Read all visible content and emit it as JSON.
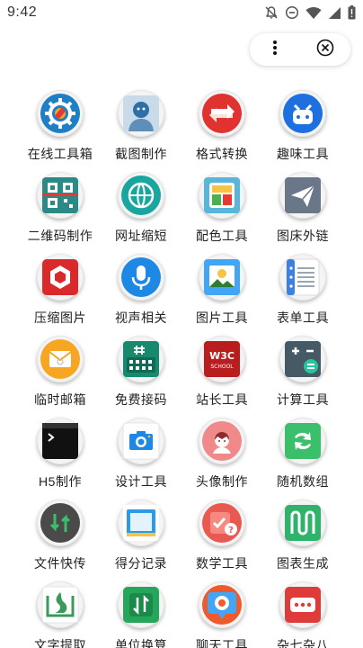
{
  "status_bar": {
    "time": "9:42",
    "icons": [
      "notifications-off-icon",
      "do-not-disturb-icon",
      "wifi-icon",
      "signal-icon",
      "battery-alert-icon"
    ]
  },
  "capsule": {
    "more_icon": "more-vertical-icon",
    "close_icon": "close-circle-icon"
  },
  "tools": [
    {
      "label": "在线工具箱",
      "icon": "gear-wrench-icon",
      "color": "#1f7fc4"
    },
    {
      "label": "截图制作",
      "icon": "portrait-photo-icon",
      "color": "#9ab8d6"
    },
    {
      "label": "格式转换",
      "icon": "swap-arrows-icon",
      "color": "#e0322f"
    },
    {
      "label": "趣味工具",
      "icon": "robot-face-icon",
      "color": "#1e6fe0"
    },
    {
      "label": "二维码制作",
      "icon": "qr-code-icon",
      "color": "#2b8a86"
    },
    {
      "label": "网址缩短",
      "icon": "globe-icon",
      "color": "#1aa6a0"
    },
    {
      "label": "配色工具",
      "icon": "color-palette-icon",
      "color": "#58b7d9"
    },
    {
      "label": "图床外链",
      "icon": "paper-plane-icon",
      "color": "#6a7788"
    },
    {
      "label": "压缩图片",
      "icon": "compress-hexagon-icon",
      "color": "#d9292b"
    },
    {
      "label": "视声相关",
      "icon": "microphone-icon",
      "color": "#1e88e5"
    },
    {
      "label": "图片工具",
      "icon": "picture-icon",
      "color": "#42a5f5"
    },
    {
      "label": "表单工具",
      "icon": "form-list-icon",
      "color": "#3f7fe0"
    },
    {
      "label": "临时邮箱",
      "icon": "email-envelope-icon",
      "color": "#f6a623"
    },
    {
      "label": "免费接码",
      "icon": "keypad-hash-icon",
      "color": "#178a6e"
    },
    {
      "label": "站长工具",
      "icon": "w3c-school-icon",
      "color": "#b91d1d"
    },
    {
      "label": "计算工具",
      "icon": "calculator-icon",
      "color": "#455a64"
    },
    {
      "label": "H5制作",
      "icon": "terminal-window-icon",
      "color": "#111111"
    },
    {
      "label": "设计工具",
      "icon": "camera-icon",
      "color": "#1e88e5"
    },
    {
      "label": "头像制作",
      "icon": "avatar-face-icon",
      "color": "#f08a8a"
    },
    {
      "label": "随机数组",
      "icon": "shuffle-arrows-icon",
      "color": "#3cbf6b"
    },
    {
      "label": "文件快传",
      "icon": "transfer-arrows-icon",
      "color": "#4a4a4a"
    },
    {
      "label": "得分记录",
      "icon": "scoreboard-icon",
      "color": "#2b9be8"
    },
    {
      "label": "数学工具",
      "icon": "math-check-icon",
      "color": "#e85a4f"
    },
    {
      "label": "图表生成",
      "icon": "chart-path-icon",
      "color": "#2fb36b"
    },
    {
      "label": "文字提取",
      "icon": "text-extract-icon",
      "color": "#3a9a5a"
    },
    {
      "label": "单位换算",
      "icon": "unit-convert-icon",
      "color": "#26a65b"
    },
    {
      "label": "聊天工具",
      "icon": "chat-gear-icon",
      "color": "#ef5a2a"
    },
    {
      "label": "杂七杂八",
      "icon": "dots-menu-icon",
      "color": "#e03b3b"
    }
  ]
}
